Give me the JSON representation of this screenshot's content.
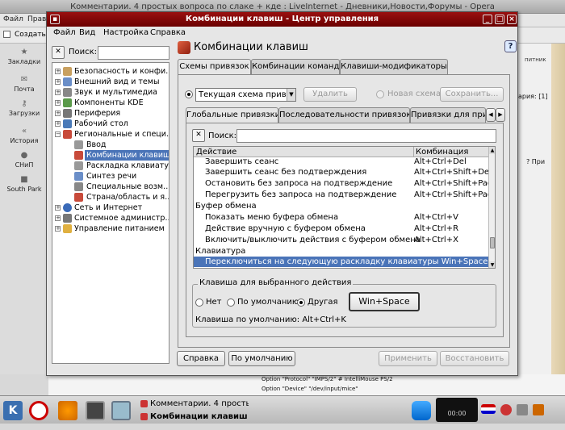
{
  "background": {
    "window_title": "Комментарии. 4 простых вопроса по слаке + кде : LiveInternet - Дневники,Новости,Форумы - Opera",
    "menu": [
      "Файл",
      "Прав"
    ],
    "toolbar_create": "Создать",
    "sidebar": [
      "Закладки",
      "Почта",
      "Загрузки",
      "История",
      "СНиП",
      "South Park"
    ],
    "right_text1": "питник",
    "right_text2": "ария: [1]",
    "right_text3": "? При",
    "bottom_line1": "Option \"Protocol\" \"IMPS/2\" # IntelliMouse PS/2",
    "bottom_line2": "Option \"Device\" \"/dev/input/mice\""
  },
  "taskbar": {
    "tasks": [
      "Комментарии. 4 простых",
      "Комбинации клавиш -"
    ],
    "clock": "00:00"
  },
  "dialog": {
    "title": "Комбинации клавиш - Центр управления",
    "menu": [
      "Файл",
      "Вид",
      "Настройка",
      "Справка"
    ],
    "search_label": "Поиск:",
    "tree": [
      {
        "label": "Безопасность и конфи…",
        "expander": "+"
      },
      {
        "label": "Внешний вид и темы",
        "expander": "+"
      },
      {
        "label": "Звук и мультимедиа",
        "expander": "+"
      },
      {
        "label": "Компоненты KDE",
        "expander": "+"
      },
      {
        "label": "Периферия",
        "expander": "+"
      },
      {
        "label": "Рабочий стол",
        "expander": "+"
      },
      {
        "label": "Региональные и специ…",
        "expander": "−"
      },
      {
        "label": "Ввод",
        "expander": ""
      },
      {
        "label": "Комбинации клавиш",
        "expander": ""
      },
      {
        "label": "Раскладка клавиатур…",
        "expander": ""
      },
      {
        "label": "Синтез речи",
        "expander": ""
      },
      {
        "label": "Специальные возм…",
        "expander": ""
      },
      {
        "label": "Страна/область и я…",
        "expander": ""
      },
      {
        "label": "Сеть и Интернет",
        "expander": "+"
      },
      {
        "label": "Системное администр…",
        "expander": "+"
      },
      {
        "label": "Управление питанием",
        "expander": "+"
      }
    ],
    "panel_title": "Комбинации клавиш",
    "help_icon": "?",
    "tabs": [
      "Схемы привязок",
      "Комбинации команд",
      "Клавиши-модификаторы"
    ],
    "scheme": {
      "current_label": "Текущая схема привязо",
      "delete_button": "Удалить",
      "new_scheme_label": "Новая схема",
      "save_button": "Сохранить..."
    },
    "subtabs": [
      "Глобальные привязки",
      "Последовательности привязок",
      "Привязки для прил"
    ],
    "sub_search_label": "Поиск:",
    "list": {
      "col_action": "Действие",
      "col_combo": "Комбинация",
      "rows": [
        {
          "action": "Завершить сеанс",
          "combo": "Alt+Ctrl+Del",
          "group": false
        },
        {
          "action": "Завершить сеанс без подтверждения",
          "combo": "Alt+Ctrl+Shift+Del",
          "group": false
        },
        {
          "action": "Остановить без запроса на подтверждение",
          "combo": "Alt+Ctrl+Shift+Page",
          "group": false
        },
        {
          "action": "Перегрузить без запроса на подтверждение",
          "combo": "Alt+Ctrl+Shift+Page",
          "group": false
        },
        {
          "action": "Буфер обмена",
          "combo": "",
          "group": true
        },
        {
          "action": "Показать меню буфера обмена",
          "combo": "Alt+Ctrl+V",
          "group": false
        },
        {
          "action": "Действие вручную с буфером обмена",
          "combo": "Alt+Ctrl+R",
          "group": false
        },
        {
          "action": "Включить/выключить действия с буфером обмена",
          "combo": "Alt+Ctrl+X",
          "group": false
        },
        {
          "action": "Клавиатура",
          "combo": "",
          "group": true
        },
        {
          "action": "Переключиться на следующую раскладку клавиатуры Win+Space",
          "combo": "",
          "group": false,
          "selected": true
        }
      ]
    },
    "key_group": {
      "title": "Клавиша для выбранного действия",
      "none": "Нет",
      "default": "По умолчанию",
      "custom": "Другая",
      "key_button": "Win+Space",
      "default_key": "Клавиша по умолчанию: Alt+Ctrl+K"
    },
    "buttons": {
      "help": "Справка",
      "defaults": "По умолчанию",
      "apply": "Применить",
      "reset": "Восстановить"
    }
  }
}
